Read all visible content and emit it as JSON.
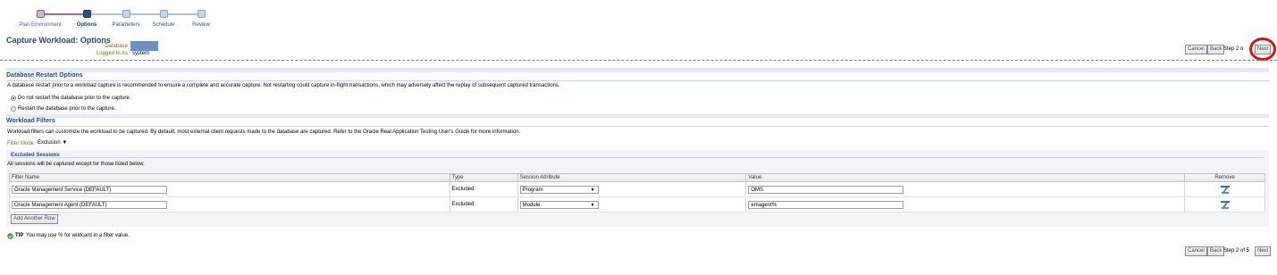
{
  "train": {
    "steps": [
      "Plan Environment",
      "Options",
      "Parameters",
      "Schedule",
      "Review"
    ],
    "current_index": 1
  },
  "header": {
    "title": "Capture Workload: Options",
    "database_label": "Database",
    "logged_in_label": "Logged In As",
    "logged_in_value": "system"
  },
  "nav_top": {
    "cancel": "Cancel",
    "back": "Back",
    "step": "Step 2 o",
    "next": "Next"
  },
  "nav_bottom": {
    "cancel": "Cancel",
    "back": "Back",
    "step": "Step 2 of 5",
    "next": "Next"
  },
  "restart": {
    "heading": "Database Restart Options",
    "description": "A database restart prior to a workload capture is recommended to ensure a complete and accurate capture. Not restarting could capture in-flight transactions, which may adversely affect the replay of subsequent captured transactions.",
    "options": [
      {
        "label": "Do not restart the database prior to the capture.",
        "selected": true
      },
      {
        "label": "Restart the database prior to the capture.",
        "selected": false
      }
    ]
  },
  "filters": {
    "heading": "Workload Filters",
    "description": "Workload filters can customize the workload to be captured. By default, most external client requests made to the database are captured. Refer to the Oracle Real Application Testing User's Guide for more information.",
    "mode_label": "Filter Mode",
    "mode_value": "Exclusion",
    "excluded": {
      "heading": "Excluded Sessions",
      "description": "All sessions will be captured except for those listed below."
    },
    "columns": [
      "Filter Name",
      "Type",
      "Session Attribute",
      "Value",
      "Remove"
    ],
    "rows": [
      {
        "name": "Oracle Management Service (DEFAULT)",
        "type": "Excluded",
        "attribute": "Program",
        "value": "OMS"
      },
      {
        "name": "Oracle Management Agent (DEFAULT)",
        "type": "Excluded",
        "attribute": "Module",
        "value": "emagent%"
      }
    ],
    "add_row": "Add Another Row"
  },
  "tip": {
    "label": "TIP",
    "text": "You may use % for wildcard in a filter value."
  },
  "colors": {
    "accent": "#27457a",
    "highlight": "#e01010",
    "section_band": "#e4ebf5"
  }
}
